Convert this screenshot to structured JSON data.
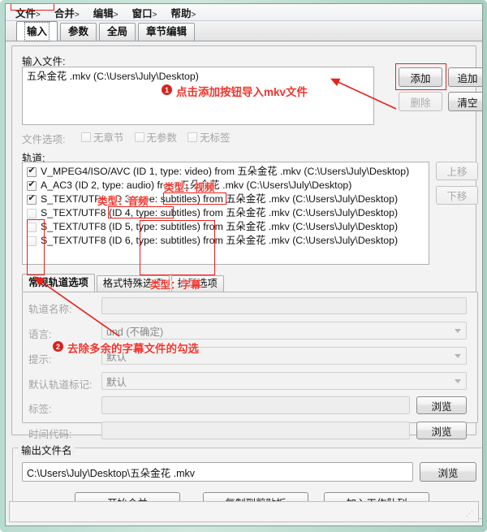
{
  "window": {
    "border_color": "#b9dcd0"
  },
  "menubar": {
    "items": [
      {
        "label": "文件",
        "caret": ">"
      },
      {
        "label": "合并",
        "caret": ">"
      },
      {
        "label": "编辑",
        "caret": ">"
      },
      {
        "label": "窗口",
        "caret": ">"
      },
      {
        "label": "帮助",
        "caret": ">"
      }
    ]
  },
  "tabs": [
    {
      "label": "输入",
      "active": true
    },
    {
      "label": "参数",
      "active": false
    },
    {
      "label": "全局",
      "active": false
    },
    {
      "label": "章节编辑",
      "active": false
    }
  ],
  "input_files": {
    "label": "输入文件:",
    "rows": [
      "五朵金花 .mkv (C:\\Users\\July\\Desktop)"
    ],
    "buttons": {
      "add": "添加",
      "append": "追加",
      "remove": "删除",
      "clear": "清空"
    }
  },
  "file_options": {
    "label": "文件选项:",
    "items": [
      {
        "label": "无章节",
        "checked": false
      },
      {
        "label": "无参数",
        "checked": false
      },
      {
        "label": "无标签",
        "checked": false
      }
    ]
  },
  "tracks": {
    "label": "轨道:",
    "rows": [
      {
        "checked": true,
        "text": "V_MPEG4/ISO/AVC (ID 1, type: video) from 五朵金花 .mkv (C:\\Users\\July\\Desktop)"
      },
      {
        "checked": true,
        "text": "A_AC3 (ID 2, type: audio) from 五朵金花 .mkv (C:\\Users\\July\\Desktop)"
      },
      {
        "checked": true,
        "text": "S_TEXT/UTF8 (ID 3, type: subtitles) from 五朵金花 .mkv (C:\\Users\\July\\Desktop)"
      },
      {
        "checked": false,
        "text": "S_TEXT/UTF8 (ID 4, type: subtitles) from 五朵金花 .mkv (C:\\Users\\July\\Desktop)"
      },
      {
        "checked": false,
        "text": "S_TEXT/UTF8 (ID 5, type: subtitles) from 五朵金花 .mkv (C:\\Users\\July\\Desktop)"
      },
      {
        "checked": false,
        "text": "S_TEXT/UTF8 (ID 6, type: subtitles) from 五朵金花 .mkv (C:\\Users\\July\\Desktop)"
      }
    ],
    "buttons": {
      "move_up": "上移",
      "move_down": "下移"
    }
  },
  "track_option_tabs": [
    {
      "label": "常规轨道选项",
      "active": true
    },
    {
      "label": "格式特殊选项",
      "active": false
    },
    {
      "label": "扩展选项",
      "active": false
    }
  ],
  "track_options": {
    "track_name": {
      "label": "轨道名称:",
      "value": ""
    },
    "language": {
      "label": "语言:",
      "value": "und (不确定)"
    },
    "cue": {
      "label": "提示:",
      "value": "默认"
    },
    "default_flag": {
      "label": "默认轨道标记:",
      "value": "默认"
    },
    "tags": {
      "label": "标签:",
      "value": "",
      "browse": "浏览"
    },
    "timecodes": {
      "label": "时间代码:",
      "value": "",
      "browse": "浏览"
    }
  },
  "output": {
    "group_title": "输出文件名",
    "value": "C:\\Users\\July\\Desktop\\五朵金花 .mkv",
    "browse": "浏览"
  },
  "actions": {
    "start": "开始合并",
    "copy_clipboard": "复制到剪贴板",
    "add_queue": "加入工作队列"
  },
  "annotations": {
    "color": "#f0352c",
    "step1": {
      "num": "1",
      "text": "点击添加按钮导入mkv文件"
    },
    "step2": {
      "num": "2",
      "text": "去除多余的字幕文件的勾选"
    },
    "type_video": "类型：视频",
    "type_audio": "类型：音频",
    "type_subtitles": "类型：字幕"
  }
}
